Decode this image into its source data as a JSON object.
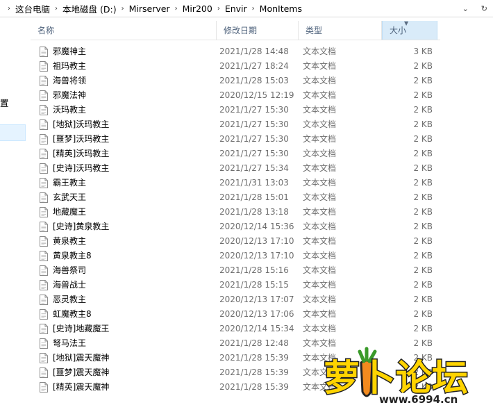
{
  "breadcrumb": [
    "这台电脑",
    "本地磁盘 (D:)",
    "Mirserver",
    "Mir200",
    "Envir",
    "MonItems"
  ],
  "nav": {
    "partial_label": "置"
  },
  "columns": {
    "name": "名称",
    "date": "修改日期",
    "type": "类型",
    "size": "大小"
  },
  "files": [
    {
      "name": "邪魔神主",
      "date": "2021/1/28 14:48",
      "type": "文本文档",
      "size": "3 KB"
    },
    {
      "name": "祖玛教主",
      "date": "2021/1/27 18:24",
      "type": "文本文档",
      "size": "2 KB"
    },
    {
      "name": "海兽将领",
      "date": "2021/1/28 15:03",
      "type": "文本文档",
      "size": "2 KB"
    },
    {
      "name": "邪魔法神",
      "date": "2020/12/15 12:19",
      "type": "文本文档",
      "size": "2 KB"
    },
    {
      "name": "沃玛教主",
      "date": "2021/1/27 15:30",
      "type": "文本文档",
      "size": "2 KB"
    },
    {
      "name": "[地狱]沃玛教主",
      "date": "2021/1/27 15:30",
      "type": "文本文档",
      "size": "2 KB"
    },
    {
      "name": "[噩梦]沃玛教主",
      "date": "2021/1/27 15:30",
      "type": "文本文档",
      "size": "2 KB"
    },
    {
      "name": "[精英]沃玛教主",
      "date": "2021/1/27 15:30",
      "type": "文本文档",
      "size": "2 KB"
    },
    {
      "name": "[史诗]沃玛教主",
      "date": "2021/1/27 15:34",
      "type": "文本文档",
      "size": "2 KB"
    },
    {
      "name": "霸王教主",
      "date": "2021/1/31 13:03",
      "type": "文本文档",
      "size": "2 KB"
    },
    {
      "name": "玄武天王",
      "date": "2021/1/28 15:01",
      "type": "文本文档",
      "size": "2 KB"
    },
    {
      "name": "地藏魔王",
      "date": "2021/1/28 13:18",
      "type": "文本文档",
      "size": "2 KB"
    },
    {
      "name": "[史诗]黄泉教主",
      "date": "2020/12/14 15:36",
      "type": "文本文档",
      "size": "2 KB"
    },
    {
      "name": "黄泉教主",
      "date": "2020/12/13 17:10",
      "type": "文本文档",
      "size": "2 KB"
    },
    {
      "name": "黄泉教主8",
      "date": "2020/12/13 17:10",
      "type": "文本文档",
      "size": "2 KB"
    },
    {
      "name": "海兽祭司",
      "date": "2021/1/28 15:16",
      "type": "文本文档",
      "size": "2 KB"
    },
    {
      "name": "海兽战士",
      "date": "2021/1/28 15:15",
      "type": "文本文档",
      "size": "2 KB"
    },
    {
      "name": "恶灵教主",
      "date": "2020/12/13 17:07",
      "type": "文本文档",
      "size": "2 KB"
    },
    {
      "name": "虹魔教主8",
      "date": "2020/12/13 17:06",
      "type": "文本文档",
      "size": "2 KB"
    },
    {
      "name": "[史诗]地藏魔王",
      "date": "2020/12/14 15:34",
      "type": "文本文档",
      "size": "2 KB"
    },
    {
      "name": "弩马法王",
      "date": "2021/1/28 12:48",
      "type": "文本文档",
      "size": "2 KB"
    },
    {
      "name": "[地狱]震天魔神",
      "date": "2021/1/28 15:39",
      "type": "文本文档",
      "size": "2 KB"
    },
    {
      "name": "[噩梦]震天魔神",
      "date": "2021/1/28 15:39",
      "type": "文本文档",
      "size": "2 KB"
    },
    {
      "name": "[精英]震天魔神",
      "date": "2021/1/28 15:39",
      "type": "文本文档",
      "size": "2 KB"
    }
  ],
  "watermark": {
    "logo_text": "萝卜论坛",
    "site": "www.6994.cn"
  },
  "colors": {
    "header_text": "#4c607a",
    "sorted_column": "#d9ebf9",
    "accent_orange": "#f28a1e"
  }
}
